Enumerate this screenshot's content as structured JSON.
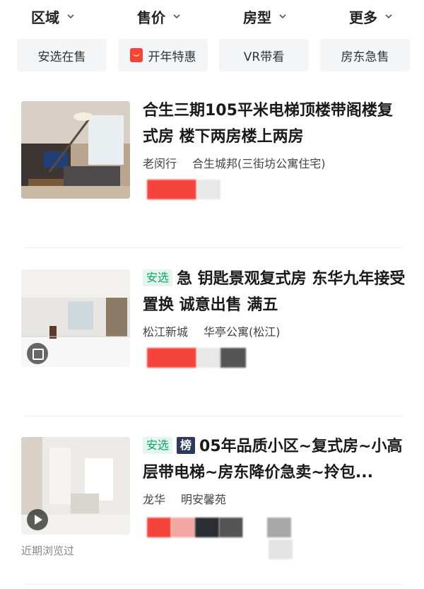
{
  "filters": [
    {
      "label": "区域"
    },
    {
      "label": "售价"
    },
    {
      "label": "房型"
    },
    {
      "label": "更多"
    }
  ],
  "tags": [
    {
      "label": "安选在售"
    },
    {
      "label": "开年特惠",
      "icon": "red-packet-icon"
    },
    {
      "label": "VR带看"
    },
    {
      "label": "房东急售"
    }
  ],
  "listings": [
    {
      "title": "合生三期105平米电梯顶楼带阁楼复式房 楼下两房楼上两房",
      "district": "老闵行",
      "community": "合生城邦(三街坊公寓住宅)",
      "badges": []
    },
    {
      "title": "急 钥匙景观复式房 东华九年接受置换 诚意出售 满五",
      "district": "松江新城",
      "community": "华亭公寓(松江)",
      "badge_anxuan": "安选",
      "thumb_icon": "vr-icon"
    },
    {
      "title": "05年品质小区~复式房~小高层带电梯~房东降价急卖~拎包...",
      "district": "龙华",
      "community": "明安馨苑",
      "badge_anxuan": "安选",
      "badge_rank": "榜",
      "thumb_icon": "play-icon",
      "recent_label": "近期浏览过"
    }
  ],
  "colors": {
    "badge_green_bg": "#e4f6ee",
    "badge_green_text": "#14a36a",
    "badge_navy": "#2d3a5e",
    "tag_bg": "#f4f5f7",
    "price_red": "#f4433a"
  }
}
